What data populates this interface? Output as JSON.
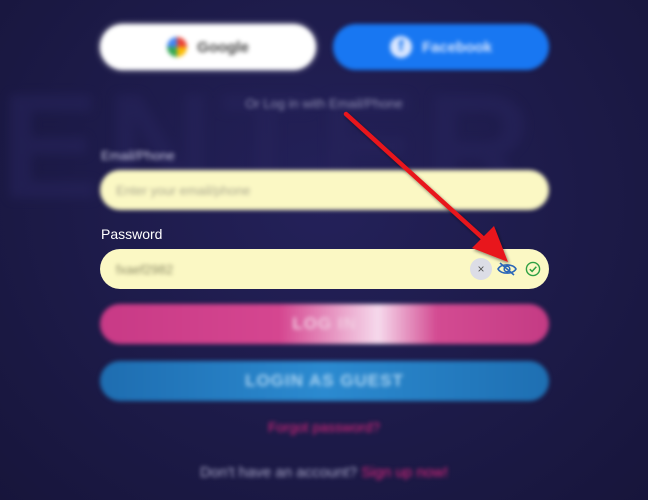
{
  "background_text": "ENTER",
  "social": {
    "google_label": "Google",
    "facebook_label": "Facebook",
    "facebook_glyph": "f"
  },
  "or_text": "Or Log in with Email/Phone",
  "email": {
    "label": "Email/Phone",
    "placeholder": "Enter your email/phone"
  },
  "password": {
    "label": "Password",
    "value": "fxaef2982",
    "clear_glyph": "×"
  },
  "buttons": {
    "login": "LOG IN",
    "guest": "LOGIN AS GUEST"
  },
  "forgot_password": "Forgot password?",
  "signup": {
    "prompt": "Don't have an account?",
    "link": "Sign up now!"
  },
  "colors": {
    "background": "#1c1a47",
    "input_fill": "#fbf8c4",
    "login_pink": "#c83a86",
    "guest_blue": "#1e6db0",
    "accent_pink": "#e0267c",
    "arrow_red": "#e8141b",
    "eye_blue": "#2a66b8",
    "check_green": "#2ea043"
  },
  "icons": [
    "google-logo",
    "facebook-logo",
    "clear-icon",
    "eye-icon",
    "check-circle-icon",
    "red-arrow-annotation"
  ]
}
